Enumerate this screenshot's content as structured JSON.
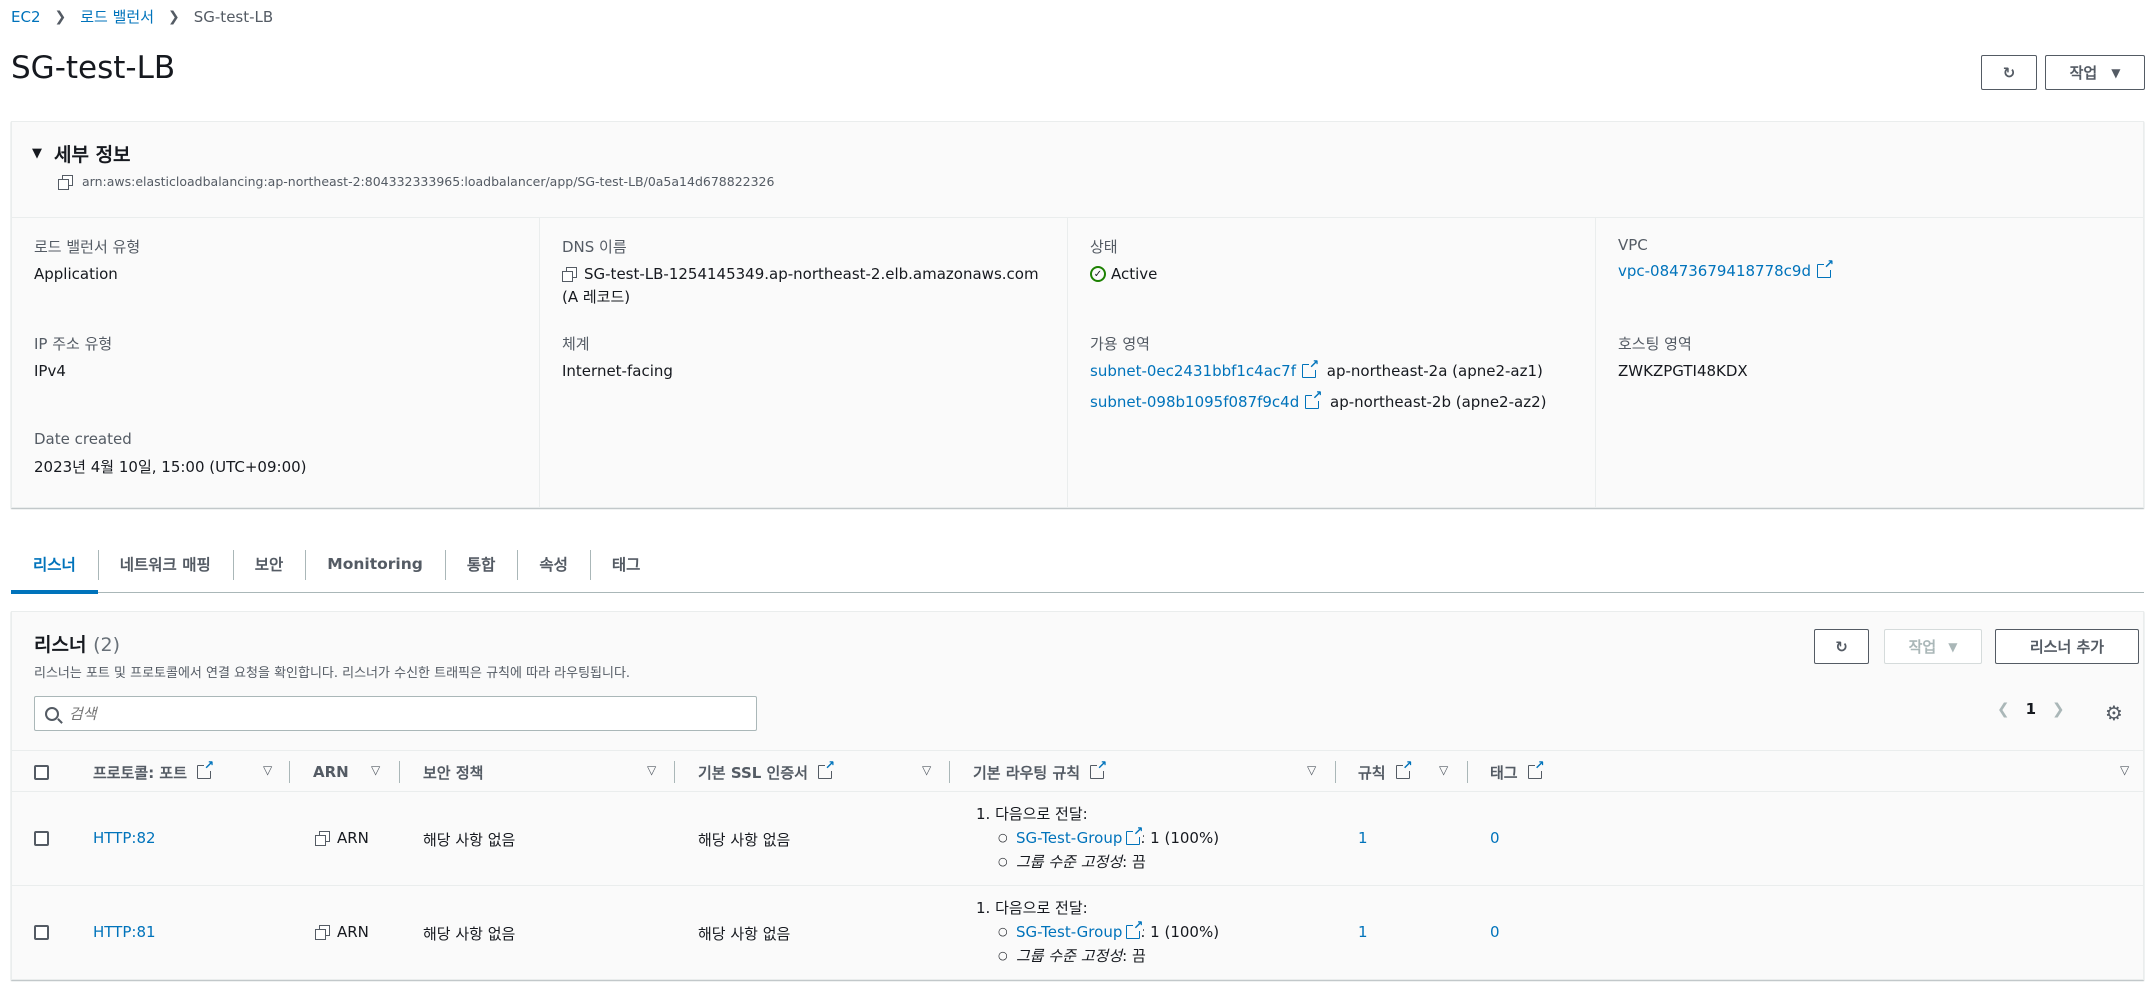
{
  "breadcrumb": {
    "ec2": "EC2",
    "lb": "로드 밸런서",
    "current": "SG-test-LB"
  },
  "page": {
    "title": "SG-test-LB",
    "action_label": "작업"
  },
  "details": {
    "title": "세부 정보",
    "arn": "arn:aws:elasticloadbalancing:ap-northeast-2:804332333965:loadbalancer/app/SG-test-LB/0a5a14d678822326",
    "lb_type_label": "로드 밸런서 유형",
    "lb_type_value": "Application",
    "dns_label": "DNS 이름",
    "dns_value": "SG-test-LB-1254145349.ap-northeast-2.elb.amazonaws.com",
    "dns_note": "(A 레코드)",
    "state_label": "상태",
    "state_value": "Active",
    "vpc_label": "VPC",
    "vpc_value": "vpc-08473679418778c9d",
    "ip_label": "IP 주소 유형",
    "ip_value": "IPv4",
    "scheme_label": "체계",
    "scheme_value": "Internet-facing",
    "az_label": "가용 영역",
    "az": [
      {
        "subnet": "subnet-0ec2431bbf1c4ac7f",
        "zone": "ap-northeast-2a (apne2-az1)"
      },
      {
        "subnet": "subnet-098b1095f087f9c4d",
        "zone": "ap-northeast-2b (apne2-az2)"
      }
    ],
    "hosted_zone_label": "호스팅 영역",
    "hosted_zone_value": "ZWKZPGTI48KDX",
    "date_label": "Date created",
    "date_value": "2023년 4월 10일, 15:00 (UTC+09:00)"
  },
  "tabs": [
    "리스너",
    "네트워크 매핑",
    "보안",
    "Monitoring",
    "통합",
    "속성",
    "태그"
  ],
  "listeners": {
    "title": "리스너",
    "count": "(2)",
    "description": "리스너는 포트 및 프로토콜에서 연결 요청을 확인합니다. 리스너가 수신한 트래픽은 규칙에 따라 라우팅됩니다.",
    "action_label": "작업",
    "add_label": "리스너 추가",
    "search_placeholder": "검색",
    "page": "1",
    "columns": {
      "protocol": "프로토콜: 포트",
      "arn": "ARN",
      "policy": "보안 정책",
      "ssl": "기본 SSL 인증서",
      "routing": "기본 라우팅 규칙",
      "rules": "규칙",
      "tags": "태그"
    },
    "rows": [
      {
        "protocol": "HTTP:82",
        "arn": "ARN",
        "policy": "해당 사항 없음",
        "ssl": "해당 사항 없음",
        "routing_head": "1. 다음으로 전달:",
        "target": "SG-Test-Group",
        "weight": ": 1 (100%)",
        "stickiness_label": "그룹 수준 고정성",
        "stickiness_value": ": 끔",
        "rules": "1",
        "tags": "0"
      },
      {
        "protocol": "HTTP:81",
        "arn": "ARN",
        "policy": "해당 사항 없음",
        "ssl": "해당 사항 없음",
        "routing_head": "1. 다음으로 전달:",
        "target": "SG-Test-Group",
        "weight": ": 1 (100%)",
        "stickiness_label": "그룹 수준 고정성",
        "stickiness_value": ": 끔",
        "rules": "1",
        "tags": "0"
      }
    ]
  }
}
